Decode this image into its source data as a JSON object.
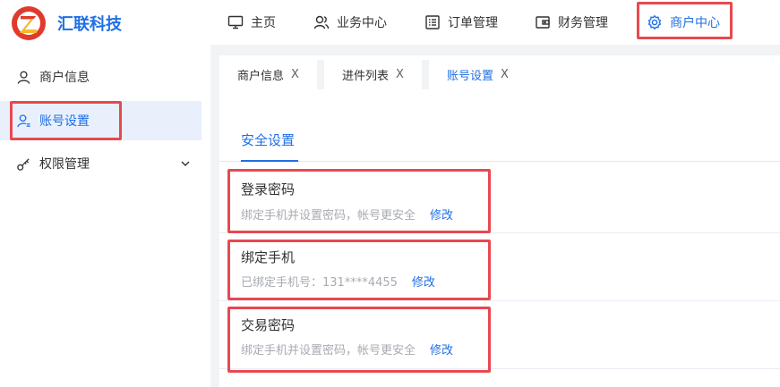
{
  "header": {
    "brand": "汇联科技",
    "nav": [
      {
        "label": "主页",
        "icon": "monitor-icon"
      },
      {
        "label": "业务中心",
        "icon": "users-icon"
      },
      {
        "label": "订单管理",
        "icon": "list-icon"
      },
      {
        "label": "财务管理",
        "icon": "wallet-icon"
      },
      {
        "label": "商户中心",
        "icon": "gear-icon",
        "active": true
      }
    ]
  },
  "sidebar": {
    "items": [
      {
        "label": "商户信息",
        "icon": "user-icon"
      },
      {
        "label": "账号设置",
        "icon": "user-settings-icon",
        "active": true
      },
      {
        "label": "权限管理",
        "icon": "key-icon",
        "expandable": true
      }
    ]
  },
  "tabs": [
    {
      "label": "商户信息",
      "close": "X"
    },
    {
      "label": "进件列表",
      "close": "X"
    },
    {
      "label": "账号设置",
      "close": "X",
      "active": true
    }
  ],
  "section": {
    "title": "安全设置",
    "items": [
      {
        "title": "登录密码",
        "desc": "绑定手机并设置密码，帐号更安全",
        "action": "修改"
      },
      {
        "title": "绑定手机",
        "desc": "已绑定手机号：131****4455",
        "action": "修改"
      },
      {
        "title": "交易密码",
        "desc": "绑定手机并设置密码，帐号更安全",
        "action": "修改"
      }
    ]
  },
  "colors": {
    "accent": "#1f6fe5",
    "highlight": "#e8484f",
    "logo_red": "#e03a2f",
    "logo_yellow": "#f5b82e"
  }
}
